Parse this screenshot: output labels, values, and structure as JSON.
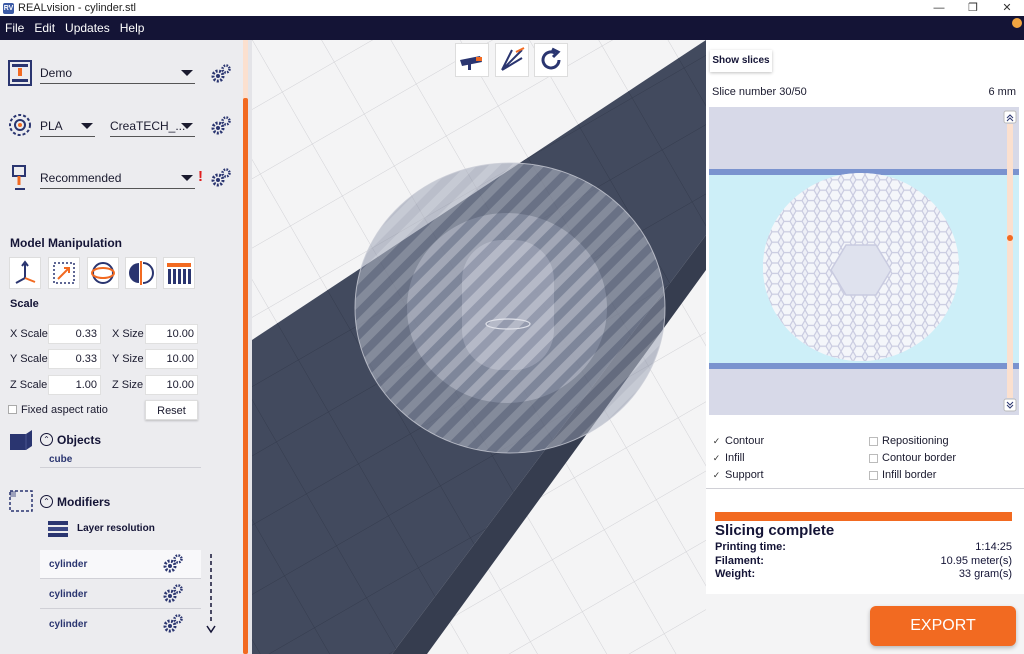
{
  "window": {
    "title": "REALvision - cylinder.stl",
    "app_icon": "RV"
  },
  "menu": [
    "File",
    "Edit",
    "Updates",
    "Help"
  ],
  "printer": {
    "selected": "Demo"
  },
  "material": {
    "type": "PLA",
    "profile": "CreaTECH_..."
  },
  "print_settings": {
    "selected": "Recommended",
    "warning": "!"
  },
  "model_manipulation": {
    "title": "Model Manipulation",
    "scale_title": "Scale",
    "x_scale_label": "X Scale",
    "x_scale": "0.33",
    "y_scale_label": "Y Scale",
    "y_scale": "0.33",
    "z_scale_label": "Z Scale",
    "z_scale": "1.00",
    "x_size_label": "X Size",
    "x_size": "10.00",
    "y_size_label": "Y Size",
    "y_size": "10.00",
    "z_size_label": "Z Size",
    "z_size": "10.00",
    "fixed_aspect_label": "Fixed aspect ratio",
    "reset_label": "Reset"
  },
  "objects": {
    "title": "Objects",
    "items": [
      "cube"
    ]
  },
  "modifiers": {
    "title": "Modifiers",
    "layer_resolution": "Layer resolution",
    "items": [
      "cylinder",
      "cylinder",
      "cylinder"
    ]
  },
  "slices": {
    "show_label": "Show slices",
    "slice_number": "Slice number 30/50",
    "height": "6 mm"
  },
  "legend": [
    {
      "label": "Contour",
      "checked": true
    },
    {
      "label": "Infill",
      "checked": true
    },
    {
      "label": "Support",
      "checked": true
    },
    {
      "label": "Repositioning",
      "checked": false
    },
    {
      "label": "Contour border",
      "checked": false
    },
    {
      "label": "Infill border",
      "checked": false
    }
  ],
  "status": {
    "title": "Slicing complete",
    "progress": 1.0,
    "printing_time_label": "Printing time:",
    "printing_time": "1:14:25",
    "filament_label": "Filament:",
    "filament": "10.95  meter(s)",
    "weight_label": "Weight:",
    "weight": "33  gram(s)"
  },
  "export_label": "EXPORT",
  "colors": {
    "accent": "#f26a21",
    "menubar": "#141436",
    "viewport_bed": "#424a5e"
  }
}
